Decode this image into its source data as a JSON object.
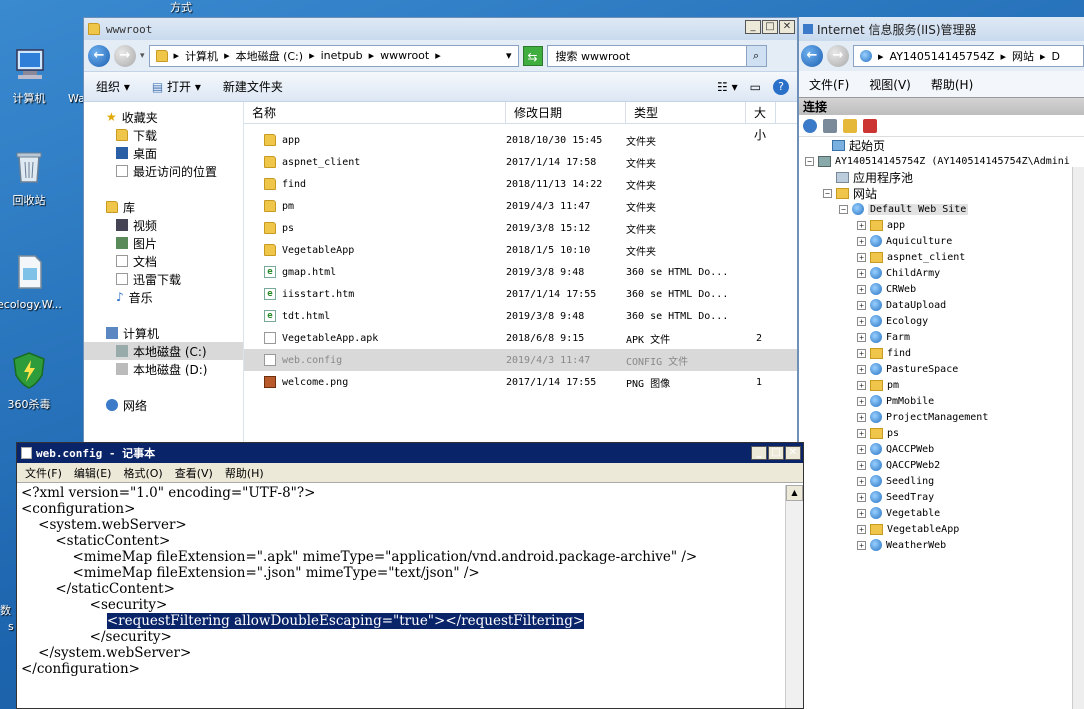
{
  "desktop": {
    "top_fragment": "方式",
    "icons": [
      {
        "label": "计算机"
      },
      {
        "label": "回收站"
      },
      {
        "label": "ecology.W..."
      },
      {
        "label": "360杀毒"
      }
    ],
    "edge_fragments": [
      "Wa",
      "数",
      "s"
    ]
  },
  "explorer": {
    "title": "wwwroot",
    "breadcrumb": [
      "计算机",
      "本地磁盘 (C:)",
      "inetpub",
      "wwwroot"
    ],
    "search_placeholder": "搜索 wwwroot",
    "toolbar": {
      "organize": "组织",
      "open": "打开",
      "new_folder": "新建文件夹"
    },
    "nav": {
      "favorites": "收藏夹",
      "favorites_items": [
        "下载",
        "桌面",
        "最近访问的位置"
      ],
      "libraries": "库",
      "library_items": [
        "视频",
        "图片",
        "文档",
        "迅雷下载",
        "音乐"
      ],
      "computer": "计算机",
      "drives": [
        "本地磁盘 (C:)",
        "本地磁盘 (D:)"
      ],
      "network": "网络"
    },
    "columns": {
      "name": "名称",
      "modified": "修改日期",
      "type": "类型",
      "size": "大小"
    },
    "files": [
      {
        "name": "app",
        "date": "2018/10/30 15:45",
        "type": "文件夹",
        "size": "",
        "icon": "folder"
      },
      {
        "name": "aspnet_client",
        "date": "2017/1/14 17:58",
        "type": "文件夹",
        "size": "",
        "icon": "folder"
      },
      {
        "name": "find",
        "date": "2018/11/13 14:22",
        "type": "文件夹",
        "size": "",
        "icon": "folder"
      },
      {
        "name": "pm",
        "date": "2019/4/3 11:47",
        "type": "文件夹",
        "size": "",
        "icon": "folder"
      },
      {
        "name": "ps",
        "date": "2019/3/8 15:12",
        "type": "文件夹",
        "size": "",
        "icon": "folder"
      },
      {
        "name": "VegetableApp",
        "date": "2018/1/5 10:10",
        "type": "文件夹",
        "size": "",
        "icon": "folder"
      },
      {
        "name": "gmap.html",
        "date": "2019/3/8 9:48",
        "type": "360 se HTML Do...",
        "size": "",
        "icon": "html"
      },
      {
        "name": "iisstart.htm",
        "date": "2017/1/14 17:55",
        "type": "360 se HTML Do...",
        "size": "",
        "icon": "html"
      },
      {
        "name": "tdt.html",
        "date": "2019/3/8 9:48",
        "type": "360 se HTML Do...",
        "size": "",
        "icon": "html"
      },
      {
        "name": "VegetableApp.apk",
        "date": "2018/6/8 9:15",
        "type": "APK 文件",
        "size": "2",
        "icon": "doc"
      },
      {
        "name": "web.config",
        "date": "2019/4/3 11:47",
        "type": "CONFIG 文件",
        "size": "",
        "icon": "doc",
        "selected": true
      },
      {
        "name": "welcome.png",
        "date": "2017/1/14 17:55",
        "type": "PNG 图像",
        "size": "1",
        "icon": "image"
      }
    ]
  },
  "iis": {
    "title": "Internet 信息服务(IIS)管理器",
    "address": [
      "AY140514145754Z",
      "网站",
      "D"
    ],
    "menu": {
      "file": "文件(F)",
      "view": "视图(V)",
      "help": "帮助(H)"
    },
    "connections": "连接",
    "tree_root": {
      "start": "起始页",
      "server": "AY140514145754Z (AY140514145754Z\\Admini",
      "app_pools": "应用程序池",
      "sites": "网站",
      "default_site": "Default Web Site"
    },
    "site_children": [
      {
        "name": "app",
        "kind": "folder"
      },
      {
        "name": "Aquiculture",
        "kind": "app"
      },
      {
        "name": "aspnet_client",
        "kind": "folder"
      },
      {
        "name": "ChildArmy",
        "kind": "app"
      },
      {
        "name": "CRWeb",
        "kind": "app"
      },
      {
        "name": "DataUpload",
        "kind": "app"
      },
      {
        "name": "Ecology",
        "kind": "app"
      },
      {
        "name": "Farm",
        "kind": "app"
      },
      {
        "name": "find",
        "kind": "folder"
      },
      {
        "name": "PastureSpace",
        "kind": "app"
      },
      {
        "name": "pm",
        "kind": "folder"
      },
      {
        "name": "PmMobile",
        "kind": "app"
      },
      {
        "name": "ProjectManagement",
        "kind": "app"
      },
      {
        "name": "ps",
        "kind": "folder"
      },
      {
        "name": "QACCPWeb",
        "kind": "app"
      },
      {
        "name": "QACCPWeb2",
        "kind": "app"
      },
      {
        "name": "Seedling",
        "kind": "app"
      },
      {
        "name": "SeedTray",
        "kind": "app"
      },
      {
        "name": "Vegetable",
        "kind": "app"
      },
      {
        "name": "VegetableApp",
        "kind": "folder"
      },
      {
        "name": "WeatherWeb",
        "kind": "app"
      }
    ]
  },
  "notepad": {
    "title": "web.config - 记事本",
    "menu": {
      "file": "文件(F)",
      "edit": "编辑(E)",
      "format": "格式(O)",
      "view": "查看(V)",
      "help": "帮助(H)"
    },
    "lines": [
      "<?xml version=\"1.0\" encoding=\"UTF-8\"?>",
      "<configuration>",
      "    <system.webServer>",
      "        <staticContent>",
      "            <mimeMap fileExtension=\".apk\" mimeType=\"application/vnd.android.package-archive\" />",
      "            <mimeMap fileExtension=\".json\" mimeType=\"text/json\" />",
      "        </staticContent>",
      "                <security>",
      "                    <requestFiltering allowDoubleEscaping=\"true\"></requestFiltering>",
      "                </security>",
      "    </system.webServer>",
      "</configuration>"
    ],
    "highlighted_line": 8
  }
}
